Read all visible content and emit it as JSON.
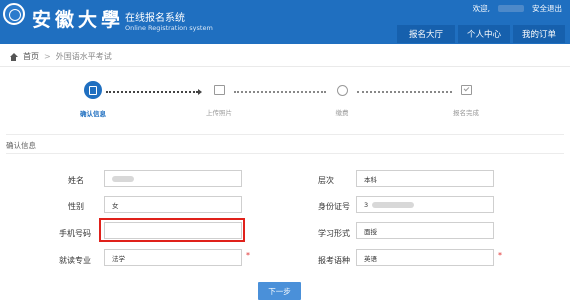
{
  "header": {
    "school_name": "安徽大學",
    "system_title": "在线报名系统",
    "system_subtitle": "Online Registration system",
    "welcome": "欢迎,",
    "logout": "安全退出",
    "nav": [
      "报名大厅",
      "个人中心",
      "我的订单"
    ]
  },
  "breadcrumb": {
    "home": "首页",
    "separator": ">",
    "current": "外国语水平考试"
  },
  "steps": [
    {
      "label": "确认信息",
      "icon": "form-icon",
      "active": true
    },
    {
      "label": "上传照片",
      "icon": "image-icon",
      "active": false
    },
    {
      "label": "缴费",
      "icon": "money-icon",
      "active": false
    },
    {
      "label": "报名完成",
      "icon": "checklist-icon",
      "active": false
    }
  ],
  "section_title": "确认信息",
  "form": {
    "name": {
      "label": "姓名",
      "value": ""
    },
    "gender": {
      "label": "性别",
      "value": "女"
    },
    "phone": {
      "label": "手机号码",
      "value": ""
    },
    "major": {
      "label": "就读专业",
      "value": "法学"
    },
    "level": {
      "label": "层次",
      "value": "本科"
    },
    "id_number": {
      "label": "身份证号",
      "value": "3"
    },
    "study_mode": {
      "label": "学习形式",
      "value": "面授"
    },
    "exam_language": {
      "label": "报考语种",
      "value": "英语"
    },
    "required_mark": "*"
  },
  "next_button": "下一步",
  "colors": {
    "header": "#1f6fc0",
    "nav_button": "#1660ad",
    "highlight": "#e0211b",
    "next_button": "#4a90d9"
  }
}
